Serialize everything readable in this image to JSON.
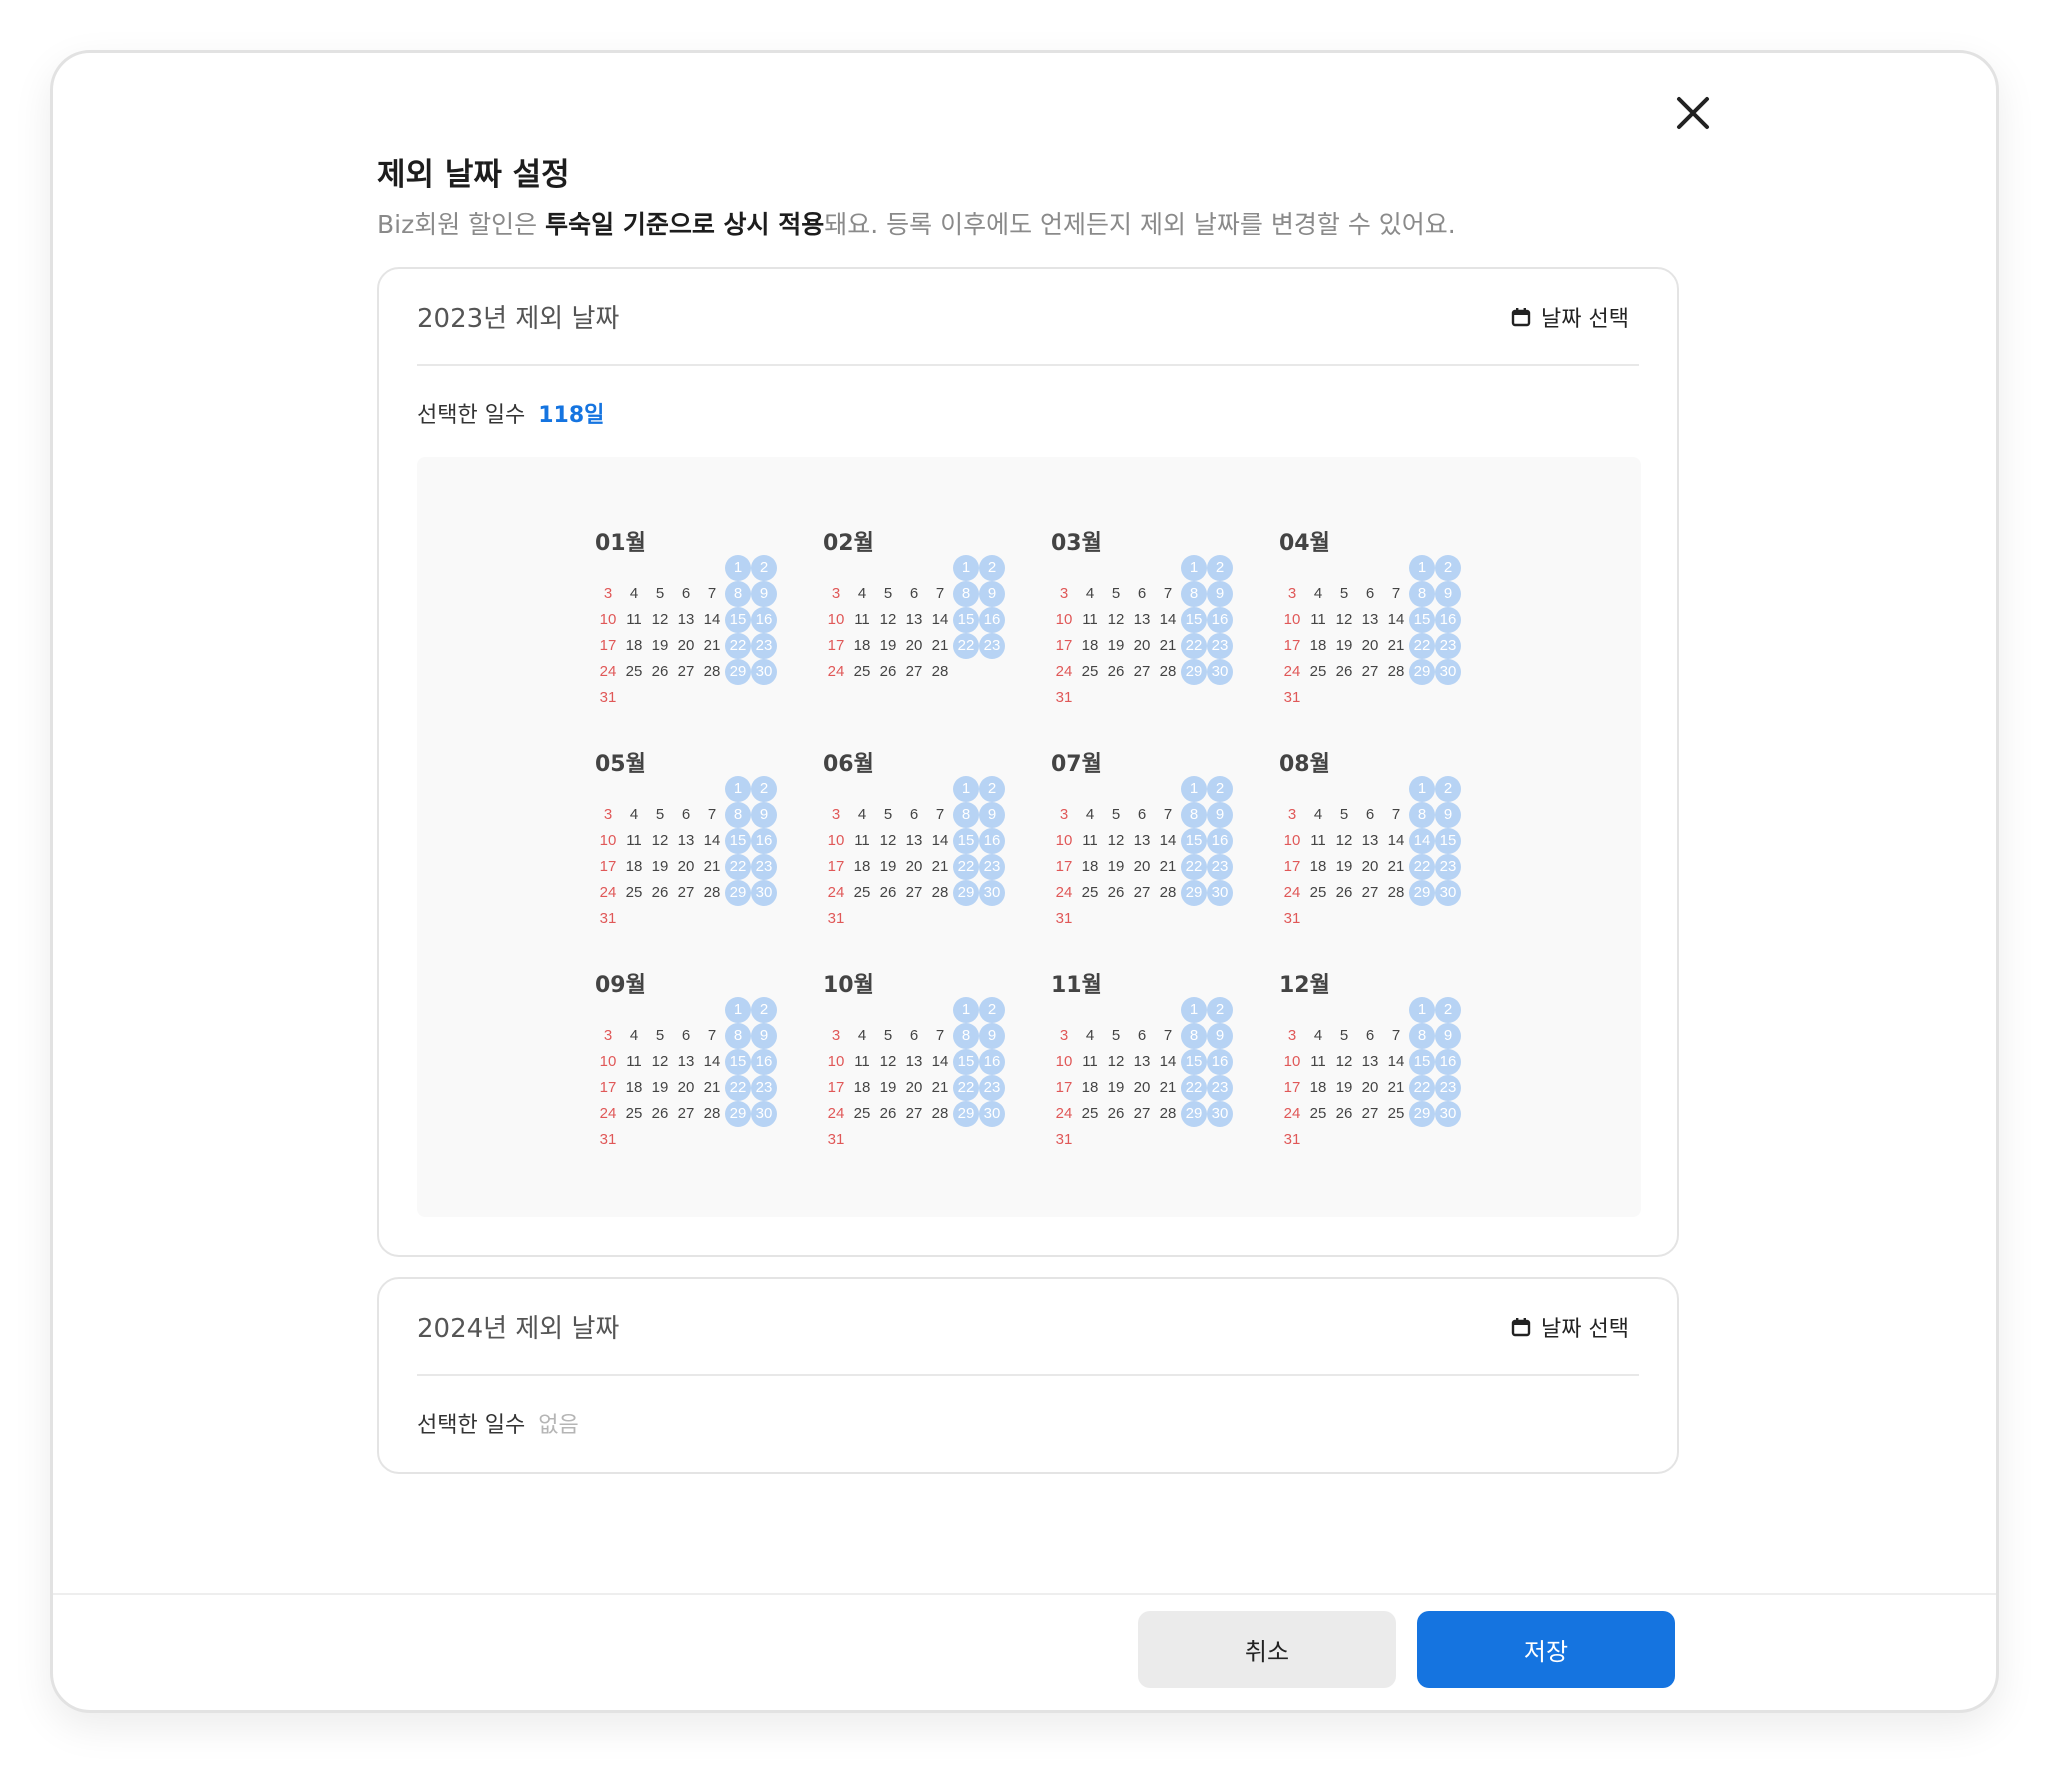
{
  "modal": {
    "title": "제외 날짜 설정",
    "description": {
      "prefix": "Biz회원 할인은 ",
      "bold": "투숙일 기준으로 상시 적용",
      "suffix": "돼요. 등록 이후에도 언제든지 제외 날짜를 변경할 수 있어요."
    },
    "close_icon": "close-icon"
  },
  "cards": [
    {
      "title": "2023년 제외 날짜",
      "date_select_label": "날짜 선택",
      "count_label": "선택한 일수",
      "count_value": "118일",
      "months": [
        {
          "label": "01월",
          "rows": [
            [
              "",
              "",
              "",
              "",
              "",
              "1",
              "2"
            ],
            [
              "3",
              "4",
              "5",
              "6",
              "7",
              "8",
              "9"
            ],
            [
              "10",
              "11",
              "12",
              "13",
              "14",
              "15",
              "16"
            ],
            [
              "17",
              "18",
              "19",
              "20",
              "21",
              "22",
              "23"
            ],
            [
              "24",
              "25",
              "26",
              "27",
              "28",
              "29",
              "30"
            ],
            [
              "31",
              "",
              "",
              "",
              "",
              "",
              ""
            ]
          ],
          "selected": [
            "1",
            "2",
            "8",
            "9",
            "15",
            "16",
            "22",
            "23",
            "29",
            "30"
          ]
        },
        {
          "label": "02월",
          "rows": [
            [
              "",
              "",
              "",
              "",
              "",
              "1",
              "2"
            ],
            [
              "3",
              "4",
              "5",
              "6",
              "7",
              "8",
              "9"
            ],
            [
              "10",
              "11",
              "12",
              "13",
              "14",
              "15",
              "16"
            ],
            [
              "17",
              "18",
              "19",
              "20",
              "21",
              "22",
              "23"
            ],
            [
              "24",
              "25",
              "26",
              "27",
              "28",
              "",
              ""
            ]
          ],
          "selected": [
            "1",
            "2",
            "8",
            "9",
            "15",
            "16",
            "22",
            "23"
          ]
        },
        {
          "label": "03월",
          "rows": [
            [
              "",
              "",
              "",
              "",
              "",
              "1",
              "2"
            ],
            [
              "3",
              "4",
              "5",
              "6",
              "7",
              "8",
              "9"
            ],
            [
              "10",
              "11",
              "12",
              "13",
              "14",
              "15",
              "16"
            ],
            [
              "17",
              "18",
              "19",
              "20",
              "21",
              "22",
              "23"
            ],
            [
              "24",
              "25",
              "26",
              "27",
              "28",
              "29",
              "30"
            ],
            [
              "31",
              "",
              "",
              "",
              "",
              "",
              ""
            ]
          ],
          "selected": [
            "1",
            "2",
            "8",
            "9",
            "15",
            "16",
            "22",
            "23",
            "29",
            "30"
          ]
        },
        {
          "label": "04월",
          "rows": [
            [
              "",
              "",
              "",
              "",
              "",
              "1",
              "2"
            ],
            [
              "3",
              "4",
              "5",
              "6",
              "7",
              "8",
              "9"
            ],
            [
              "10",
              "11",
              "12",
              "13",
              "14",
              "15",
              "16"
            ],
            [
              "17",
              "18",
              "19",
              "20",
              "21",
              "22",
              "23"
            ],
            [
              "24",
              "25",
              "26",
              "27",
              "28",
              "29",
              "30"
            ],
            [
              "31",
              "",
              "",
              "",
              "",
              "",
              ""
            ]
          ],
          "selected": [
            "1",
            "2",
            "8",
            "9",
            "15",
            "16",
            "22",
            "23",
            "29",
            "30"
          ]
        },
        {
          "label": "05월",
          "rows": [
            [
              "",
              "",
              "",
              "",
              "",
              "1",
              "2"
            ],
            [
              "3",
              "4",
              "5",
              "6",
              "7",
              "8",
              "9"
            ],
            [
              "10",
              "11",
              "12",
              "13",
              "14",
              "15",
              "16"
            ],
            [
              "17",
              "18",
              "19",
              "20",
              "21",
              "22",
              "23"
            ],
            [
              "24",
              "25",
              "26",
              "27",
              "28",
              "29",
              "30"
            ],
            [
              "31",
              "",
              "",
              "",
              "",
              "",
              ""
            ]
          ],
          "selected": [
            "1",
            "2",
            "8",
            "9",
            "15",
            "16",
            "22",
            "23",
            "29",
            "30"
          ]
        },
        {
          "label": "06월",
          "rows": [
            [
              "",
              "",
              "",
              "",
              "",
              "1",
              "2"
            ],
            [
              "3",
              "4",
              "5",
              "6",
              "7",
              "8",
              "9"
            ],
            [
              "10",
              "11",
              "12",
              "13",
              "14",
              "15",
              "16"
            ],
            [
              "17",
              "18",
              "19",
              "20",
              "21",
              "22",
              "23"
            ],
            [
              "24",
              "25",
              "26",
              "27",
              "28",
              "29",
              "30"
            ],
            [
              "31",
              "",
              "",
              "",
              "",
              "",
              ""
            ]
          ],
          "selected": [
            "1",
            "2",
            "8",
            "9",
            "15",
            "16",
            "22",
            "23",
            "29",
            "30"
          ]
        },
        {
          "label": "07월",
          "rows": [
            [
              "",
              "",
              "",
              "",
              "",
              "1",
              "2"
            ],
            [
              "3",
              "4",
              "5",
              "6",
              "7",
              "8",
              "9"
            ],
            [
              "10",
              "11",
              "12",
              "13",
              "14",
              "15",
              "16"
            ],
            [
              "17",
              "18",
              "19",
              "20",
              "21",
              "22",
              "23"
            ],
            [
              "24",
              "25",
              "26",
              "27",
              "28",
              "29",
              "30"
            ],
            [
              "31",
              "",
              "",
              "",
              "",
              "",
              ""
            ]
          ],
          "selected": [
            "1",
            "2",
            "8",
            "9",
            "15",
            "16",
            "22",
            "23",
            "29",
            "30"
          ]
        },
        {
          "label": "08월",
          "rows": [
            [
              "",
              "",
              "",
              "",
              "",
              "1",
              "2"
            ],
            [
              "3",
              "4",
              "5",
              "6",
              "7",
              "8",
              "9"
            ],
            [
              "10",
              "11",
              "12",
              "13",
              "14",
              "14",
              "15"
            ],
            [
              "17",
              "18",
              "19",
              "20",
              "21",
              "22",
              "23"
            ],
            [
              "24",
              "25",
              "26",
              "27",
              "28",
              "29",
              "30"
            ],
            [
              "31",
              "",
              "",
              "",
              "",
              "",
              ""
            ]
          ],
          "selected": [
            "1",
            "2",
            "8",
            "9",
            "14",
            "15",
            "22",
            "23",
            "29",
            "30"
          ]
        },
        {
          "label": "09월",
          "rows": [
            [
              "",
              "",
              "",
              "",
              "",
              "1",
              "2"
            ],
            [
              "3",
              "4",
              "5",
              "6",
              "7",
              "8",
              "9"
            ],
            [
              "10",
              "11",
              "12",
              "13",
              "14",
              "15",
              "16"
            ],
            [
              "17",
              "18",
              "19",
              "20",
              "21",
              "22",
              "23"
            ],
            [
              "24",
              "25",
              "26",
              "27",
              "28",
              "29",
              "30"
            ],
            [
              "31",
              "",
              "",
              "",
              "",
              "",
              ""
            ]
          ],
          "selected": [
            "1",
            "2",
            "8",
            "9",
            "15",
            "16",
            "22",
            "23",
            "29",
            "30"
          ]
        },
        {
          "label": "10월",
          "rows": [
            [
              "",
              "",
              "",
              "",
              "",
              "1",
              "2"
            ],
            [
              "3",
              "4",
              "5",
              "6",
              "7",
              "8",
              "9"
            ],
            [
              "10",
              "11",
              "12",
              "13",
              "14",
              "15",
              "16"
            ],
            [
              "17",
              "18",
              "19",
              "20",
              "21",
              "22",
              "23"
            ],
            [
              "24",
              "25",
              "26",
              "27",
              "28",
              "29",
              "30"
            ],
            [
              "31",
              "",
              "",
              "",
              "",
              "",
              ""
            ]
          ],
          "selected": [
            "1",
            "2",
            "8",
            "9",
            "15",
            "16",
            "22",
            "23",
            "29",
            "30"
          ]
        },
        {
          "label": "11월",
          "rows": [
            [
              "",
              "",
              "",
              "",
              "",
              "1",
              "2"
            ],
            [
              "3",
              "4",
              "5",
              "6",
              "7",
              "8",
              "9"
            ],
            [
              "10",
              "11",
              "12",
              "13",
              "14",
              "15",
              "16"
            ],
            [
              "17",
              "18",
              "19",
              "20",
              "21",
              "22",
              "23"
            ],
            [
              "24",
              "25",
              "26",
              "27",
              "28",
              "29",
              "30"
            ],
            [
              "31",
              "",
              "",
              "",
              "",
              "",
              ""
            ]
          ],
          "selected": [
            "1",
            "2",
            "8",
            "9",
            "15",
            "16",
            "22",
            "23",
            "29",
            "30"
          ]
        },
        {
          "label": "12월",
          "rows": [
            [
              "",
              "",
              "",
              "",
              "",
              "1",
              "2"
            ],
            [
              "3",
              "4",
              "5",
              "6",
              "7",
              "8",
              "9"
            ],
            [
              "10",
              "11",
              "12",
              "13",
              "14",
              "15",
              "16"
            ],
            [
              "17",
              "18",
              "19",
              "20",
              "21",
              "22",
              "23"
            ],
            [
              "24",
              "25",
              "26",
              "27",
              "25",
              "29",
              "30"
            ],
            [
              "31",
              "",
              "",
              "",
              "",
              "",
              ""
            ]
          ],
          "selected": [
            "1",
            "2",
            "8",
            "9",
            "15",
            "16",
            "22",
            "23",
            "29",
            "30"
          ]
        }
      ]
    },
    {
      "title": "2024년 제외 날짜",
      "date_select_label": "날짜 선택",
      "count_label": "선택한 일수",
      "count_value": "없음"
    }
  ],
  "footer": {
    "cancel_label": "취소",
    "save_label": "저장"
  },
  "colors": {
    "accent": "#1574e0",
    "selected_day": "#b7d3f4",
    "sunday": "#e05858",
    "panel_bg": "#f9f9f9"
  }
}
